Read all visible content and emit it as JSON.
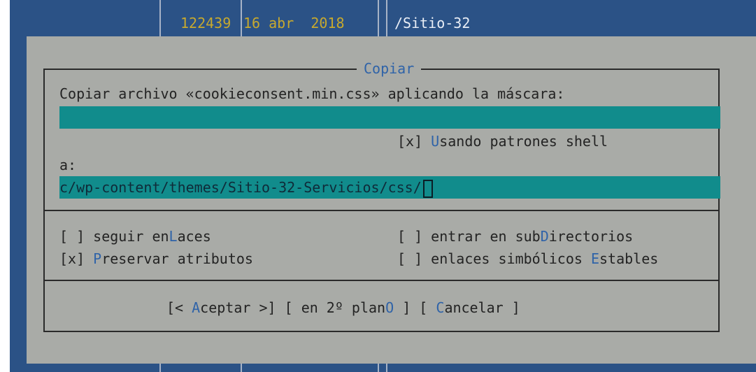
{
  "background_panel": {
    "size_col": "122439",
    "date_col": "16 abr  2018",
    "name_col": "/Sitio-32"
  },
  "dialog": {
    "title": "Copiar",
    "prompt": "Copiar archivo «cookieconsent.min.css» aplicando la máscara:",
    "mask_value": "*",
    "shell_patterns": {
      "check": "[x]",
      "pre": "",
      "hotkey": "U",
      "post": "sando patrones shell"
    },
    "to_label": "a:",
    "destination_value": "c/wp-content/themes/Sitio-32-Servicios/css/",
    "options": {
      "follow_links": {
        "check": "[ ]",
        "pre": "seguir en",
        "hotkey": "L",
        "post": "aces"
      },
      "dive_subdirs": {
        "check": "[ ]",
        "pre": "entrar en sub",
        "hotkey": "D",
        "post": "irectorios"
      },
      "preserve_attrs": {
        "check": "[x]",
        "pre": "",
        "hotkey": "P",
        "post": "reservar atributos"
      },
      "stable_symlinks": {
        "check": "[ ]",
        "pre": "enlaces simbólicos ",
        "hotkey": "E",
        "post": "stables"
      }
    },
    "buttons": {
      "ok": {
        "open": "[< ",
        "hotkey": "A",
        "rest": "ceptar",
        "close": " >]"
      },
      "background": {
        "open": "[ ",
        "pre": "en 2º plan",
        "hotkey": "O",
        "close": " ]"
      },
      "cancel": {
        "open": "[ ",
        "hotkey": "C",
        "rest": "ancelar",
        "close": " ]"
      }
    }
  },
  "colors": {
    "panel_bg": "#2b5286",
    "dialog_bg": "#a9aba7",
    "input_bg": "#118c8c",
    "hotkey": "#2f63a8",
    "panel_yellow": "#c7a92e"
  }
}
